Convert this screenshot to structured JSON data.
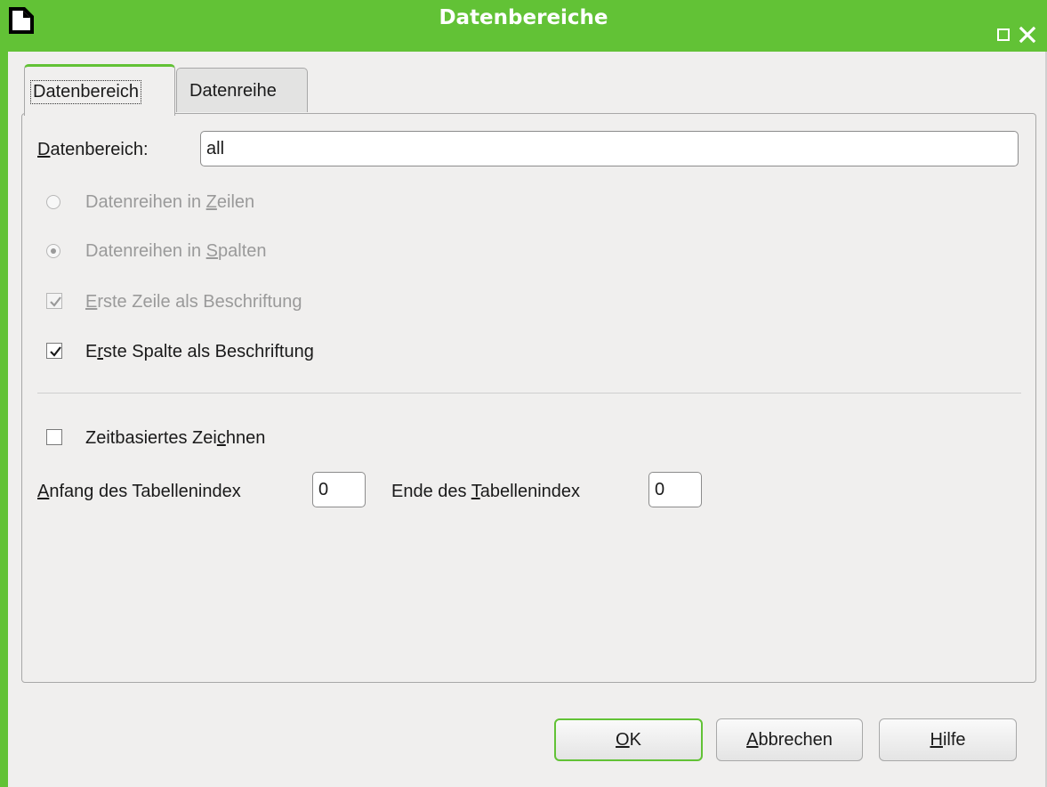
{
  "window": {
    "title": "Datenbereiche",
    "icons": {
      "app": "libreoffice-document-icon",
      "maximize": "maximize-icon",
      "close": "close-icon"
    },
    "accent_color": "#62c236"
  },
  "tabs": [
    {
      "label": "Datenbereich",
      "active": true
    },
    {
      "label": "Datenreihe",
      "active": false
    }
  ],
  "range": {
    "label_mnemonic": "D",
    "label_rest": "atenbereich:",
    "value": "all"
  },
  "options": {
    "rows": {
      "pre": "Datenreihen in ",
      "mnemonic": "Z",
      "post": "eilen",
      "checked": false,
      "enabled": false
    },
    "columns": {
      "pre": "Datenreihen in ",
      "mnemonic": "S",
      "post": "palten",
      "checked": true,
      "enabled": false
    },
    "first_row": {
      "pre": "",
      "mnemonic": "E",
      "post": "rste Zeile als Beschriftung",
      "checked": true,
      "enabled": false
    },
    "first_column": {
      "pre": "E",
      "mnemonic": "r",
      "post": "ste Spalte als Beschriftung",
      "checked": true,
      "enabled": true
    },
    "time_based": {
      "pre": "Zeitbasiertes Zei",
      "mnemonic": "c",
      "post": "hnen",
      "checked": false,
      "enabled": true
    }
  },
  "table_index": {
    "start_mnemonic": "A",
    "start_rest": "nfang des Tabellenindex",
    "start_value": "0",
    "end_pre": "Ende des ",
    "end_mnemonic": "T",
    "end_post": "abellenindex",
    "end_value": "0"
  },
  "buttons": {
    "ok_mnemonic": "O",
    "ok_rest": "K",
    "cancel_mnemonic": "A",
    "cancel_rest": "bbrechen",
    "help_mnemonic": "H",
    "help_rest": "ilfe"
  }
}
